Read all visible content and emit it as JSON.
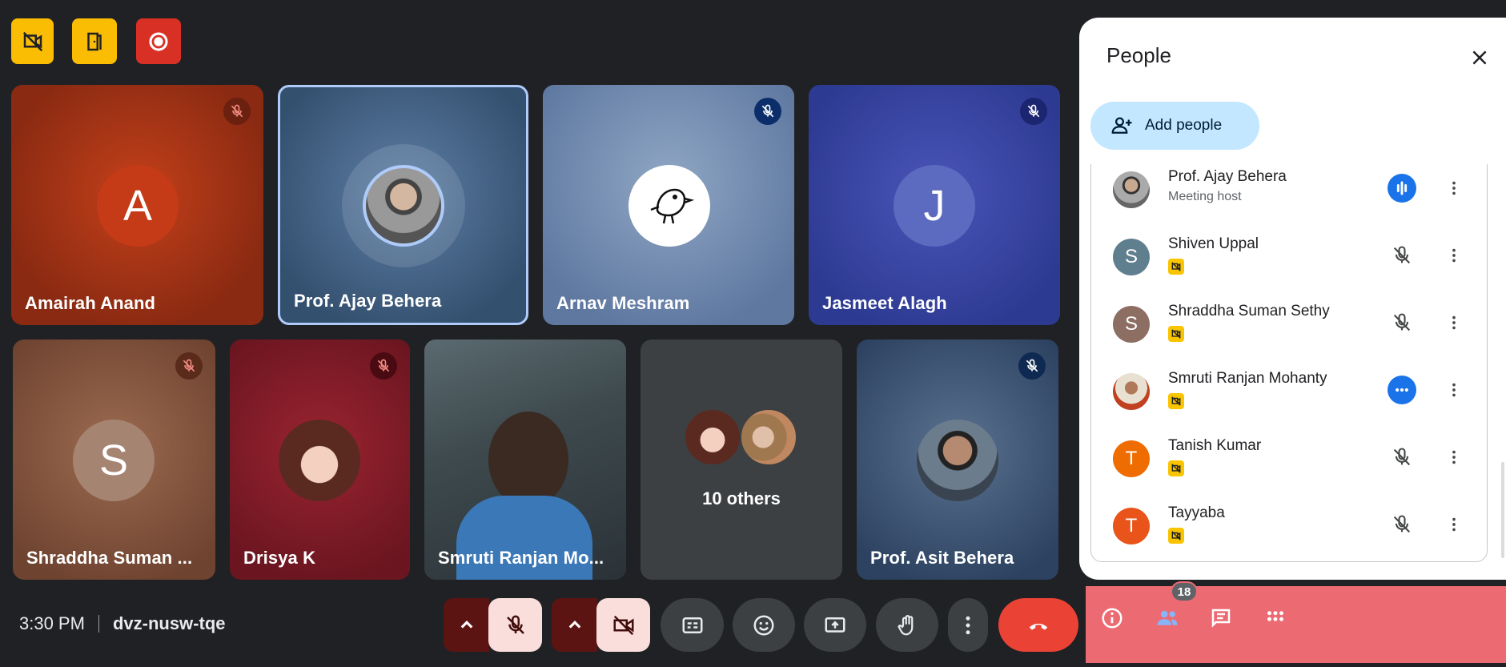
{
  "meeting": {
    "time": "3:30 PM",
    "code": "dvz-nusw-tqe"
  },
  "top_buttons": [
    {
      "icon": "no-video-host-icon",
      "color": "#fbbc04"
    },
    {
      "icon": "door-exit-icon",
      "color": "#fbbc04"
    },
    {
      "icon": "record-icon",
      "color": "#d93025"
    }
  ],
  "tiles": [
    {
      "name": "Amairah Anand",
      "avatar_letter": "A"
    },
    {
      "name": "Prof. Ajay Behera"
    },
    {
      "name": "Arnav Meshram"
    },
    {
      "name": "Jasmeet Alagh",
      "avatar_letter": "J"
    },
    {
      "name": "Shraddha Suman ...",
      "avatar_letter": "S"
    },
    {
      "name": "Drisya K"
    },
    {
      "name": "Smruti Ranjan Mo..."
    },
    {
      "name": "10 others"
    },
    {
      "name": "Prof. Asit Behera"
    }
  ],
  "people_panel": {
    "title": "People",
    "add_label": "Add people",
    "participants": [
      {
        "name": "Prof. Ajay Behera",
        "subtitle": "Meeting host",
        "status": "speaking"
      },
      {
        "name": "Shiven Uppal",
        "letter": "S",
        "status": "muted"
      },
      {
        "name": "Shraddha Suman Sethy",
        "letter": "S",
        "status": "muted"
      },
      {
        "name": "Smruti Ranjan Mohanty",
        "status": "more"
      },
      {
        "name": "Tanish Kumar",
        "letter": "T",
        "status": "muted"
      },
      {
        "name": "Tayyaba",
        "letter": "T",
        "status": "muted"
      }
    ]
  },
  "sidebar": {
    "people_count": "18"
  },
  "colors": {
    "accent": "#1a73e8",
    "hangup": "#ea4335",
    "panel_bg": "#ffffff",
    "side_bar": "#ec6a72"
  }
}
